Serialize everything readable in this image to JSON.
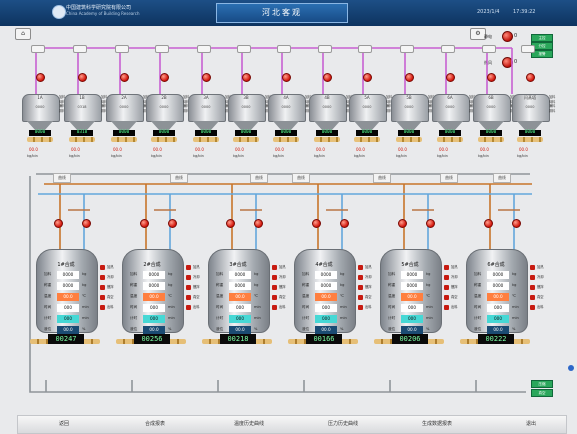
{
  "header": {
    "org_cn": "中国建筑科学研究院有限公司",
    "org_en": "China Academy of Building Research",
    "title": "河北客观",
    "date": "2023/1/4",
    "time": "17:39:22"
  },
  "top_controls": {
    "home_icon": "home-icon",
    "indicators": [
      {
        "label": "静电",
        "value": "0"
      },
      {
        "label": "热风",
        "value": "0"
      }
    ],
    "status_tags": [
      "主控",
      "分控",
      "报警"
    ]
  },
  "silos": [
    {
      "name": "1A",
      "value": "0000",
      "unit": "kg/bin",
      "meter": "00.0"
    },
    {
      "name": "1B",
      "value": "0318",
      "unit": "kg/bin",
      "meter": "00.0"
    },
    {
      "name": "2A",
      "value": "0000",
      "unit": "kg/bin",
      "meter": "00.0"
    },
    {
      "name": "2B",
      "value": "0000",
      "unit": "kg/bin",
      "meter": "00.0"
    },
    {
      "name": "3A",
      "value": "0000",
      "unit": "kg/bin",
      "meter": "00.0"
    },
    {
      "name": "3B",
      "value": "0000",
      "unit": "kg/bin",
      "meter": "00.0"
    },
    {
      "name": "4A",
      "value": "0000",
      "unit": "kg/bin",
      "meter": "00.0"
    },
    {
      "name": "4B",
      "value": "0000",
      "unit": "kg/bin",
      "meter": "00.0"
    },
    {
      "name": "5A",
      "value": "0000",
      "unit": "kg/bin",
      "meter": "00.0"
    },
    {
      "name": "5B",
      "value": "0000",
      "unit": "kg/bin",
      "meter": "00.0"
    },
    {
      "name": "6A",
      "value": "0000",
      "unit": "kg/bin",
      "meter": "00.0"
    },
    {
      "name": "6B",
      "value": "0000",
      "unit": "kg/bin",
      "meter": "00.0"
    },
    {
      "name": "闪蒸塔",
      "value": "0000",
      "unit": "kg/bin",
      "meter": "00.0"
    }
  ],
  "silo_status_labels": [
    "加料",
    "待料",
    "满料",
    "排料"
  ],
  "silo_buttons": [
    "曲线",
    "曲线",
    "曲线",
    "曲线",
    "曲线",
    "曲线",
    "曲线"
  ],
  "reactors": [
    {
      "title": "1#合成",
      "weight": "0000",
      "weight2": "0000",
      "temp_a": "00.0",
      "temp_b": "00.0",
      "time1": "000",
      "time2": "000",
      "level": "00.0",
      "bottom": "00247"
    },
    {
      "title": "2#合成",
      "weight": "0000",
      "weight2": "0000",
      "temp_a": "00.0",
      "temp_b": "00.0",
      "time1": "000",
      "time2": "000",
      "level": "00.0",
      "bottom": "00256"
    },
    {
      "title": "3#合成",
      "weight": "0000",
      "weight2": "0000",
      "temp_a": "00.0",
      "temp_b": "00.0",
      "time1": "000",
      "time2": "000",
      "level": "00.0",
      "bottom": "00218"
    },
    {
      "title": "4#合成",
      "weight": "0000",
      "weight2": "0000",
      "temp_a": "00.0",
      "temp_b": "00.0",
      "time1": "000",
      "time2": "000",
      "level": "00.0",
      "bottom": "00166"
    },
    {
      "title": "5#合成",
      "weight": "0000",
      "weight2": "0000",
      "temp_a": "00.0",
      "temp_b": "00.0",
      "time1": "000",
      "time2": "000",
      "level": "00.0",
      "bottom": "00206"
    },
    {
      "title": "6#合成",
      "weight": "0000",
      "weight2": "0000",
      "temp_a": "00.0",
      "temp_b": "00.0",
      "time1": "000",
      "time2": "000",
      "level": "00.0",
      "bottom": "00222"
    }
  ],
  "reactor_row_labels": [
    "加料",
    "称重",
    "温度",
    "时间",
    "计时",
    "液位"
  ],
  "reactor_row_units": [
    "kg",
    "kg",
    "℃",
    "min",
    "min",
    "%"
  ],
  "reactor_side_labels": [
    "加热",
    "冷却",
    "搅拌",
    "真空",
    "出料"
  ],
  "bottom_legend": [
    "压缩",
    "真空"
  ],
  "footer": {
    "buttons": [
      "返回",
      "合成报表",
      "温度历史曲线",
      "压力历史曲线",
      "生成数据报表",
      "退出"
    ]
  }
}
